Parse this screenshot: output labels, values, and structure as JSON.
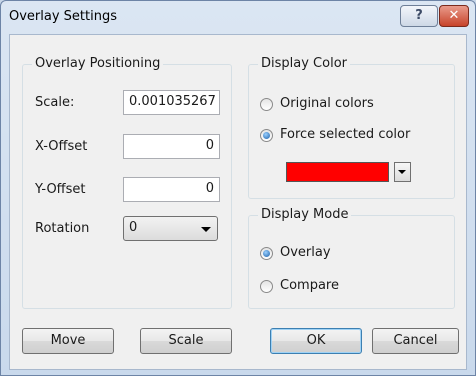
{
  "window": {
    "title": "Overlay Settings",
    "help_label": "?",
    "close_label": "✕"
  },
  "positioning": {
    "legend": "Overlay Positioning",
    "scale_label": "Scale:",
    "scale_value": "0.001035267",
    "xoffset_label": "X-Offset",
    "xoffset_value": "0",
    "yoffset_label": "Y-Offset",
    "yoffset_value": "0",
    "rotation_label": "Rotation",
    "rotation_value": "0"
  },
  "display_color": {
    "legend": "Display Color",
    "original_label": "Original colors",
    "force_label": "Force selected color",
    "selected": "force",
    "color": "#ff0000"
  },
  "display_mode": {
    "legend": "Display Mode",
    "overlay_label": "Overlay",
    "compare_label": "Compare",
    "selected": "overlay"
  },
  "buttons": {
    "move": "Move",
    "scale": "Scale",
    "ok": "OK",
    "cancel": "Cancel"
  }
}
